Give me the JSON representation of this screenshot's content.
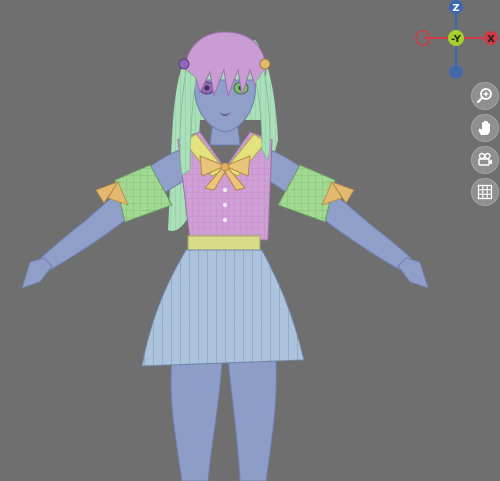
{
  "viewport": {
    "background": "#6f6f6f"
  },
  "gizmo": {
    "z_label": "Z",
    "y_label": "-Y",
    "x_label": "X",
    "z_color": "#3b66b8",
    "y_color": "#a6cf2a",
    "x_color": "#cf3a45"
  },
  "tools": [
    {
      "name": "zoom-button",
      "icon": "zoom-in-icon"
    },
    {
      "name": "pan-button",
      "icon": "hand-icon"
    },
    {
      "name": "camera-button",
      "icon": "camera-icon"
    },
    {
      "name": "grid-button",
      "icon": "grid-icon"
    }
  ],
  "model": {
    "skin_color": "#8f9fc9",
    "hair_color": "#a9dfb9",
    "vest_color": "#cf9fd6",
    "skirt_color": "#a9c0dc",
    "sleeve_color": "#9fd896",
    "bow_color": "#e8c678"
  }
}
